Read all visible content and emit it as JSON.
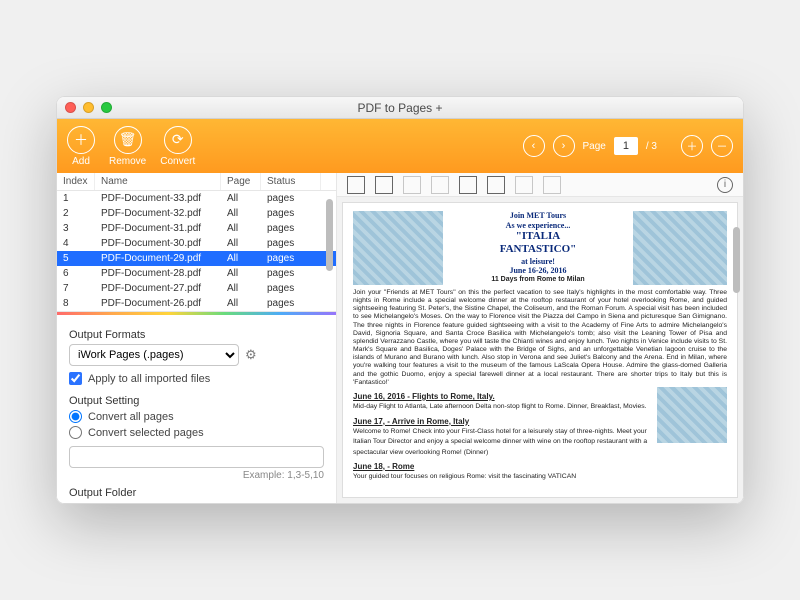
{
  "window": {
    "title": "PDF to Pages +"
  },
  "toolbar": {
    "add": "Add",
    "remove": "Remove",
    "convert": "Convert",
    "page_label": "Page",
    "page_current": "1",
    "page_total": "/ 3"
  },
  "filelist": {
    "headers": {
      "index": "Index",
      "name": "Name",
      "page": "Page",
      "status": "Status"
    },
    "rows": [
      {
        "index": "1",
        "name": "PDF-Document-33.pdf",
        "page": "All",
        "status": "pages"
      },
      {
        "index": "2",
        "name": "PDF-Document-32.pdf",
        "page": "All",
        "status": "pages"
      },
      {
        "index": "3",
        "name": "PDF-Document-31.pdf",
        "page": "All",
        "status": "pages"
      },
      {
        "index": "4",
        "name": "PDF-Document-30.pdf",
        "page": "All",
        "status": "pages"
      },
      {
        "index": "5",
        "name": "PDF-Document-29.pdf",
        "page": "All",
        "status": "pages",
        "selected": true
      },
      {
        "index": "6",
        "name": "PDF-Document-28.pdf",
        "page": "All",
        "status": "pages"
      },
      {
        "index": "7",
        "name": "PDF-Document-27.pdf",
        "page": "All",
        "status": "pages"
      },
      {
        "index": "8",
        "name": "PDF-Document-26.pdf",
        "page": "All",
        "status": "pages"
      }
    ]
  },
  "settings": {
    "output_formats_label": "Output Formats",
    "format_selected": "iWork Pages (.pages)",
    "apply_all": "Apply to all imported files",
    "output_setting_label": "Output Setting",
    "convert_all": "Convert all pages",
    "convert_selected": "Convert selected pages",
    "range_example": "Example: 1,3-5,10",
    "output_folder_label": "Output Folder"
  },
  "preview": {
    "head": {
      "l1": "Join MET Tours",
      "l2": "As we experience...",
      "l3": "\"ITALIA",
      "l4": "FANTASTICO\"",
      "l5": "at leisure!",
      "l6": "June 16-26, 2016",
      "l7": "11 Days from Rome to Milan"
    },
    "intro": "Join your \"Friends at MET Tours\" on this the perfect vacation to see Italy's highlights in the most comfortable way. Three nights in Rome include a special welcome dinner at the rooftop restaurant of your hotel overlooking Rome, and guided sightseeing featuring St. Peter's, the Sistine Chapel, the Coliseum, and the Roman Forum. A special visit has been included to see Michelangelo's Moses. On the way to Florence visit the Piazza del Campo in Siena and picturesque San Gimignano. The three nights in Florence feature guided sightseeing with a visit to the Academy of Fine Arts to admire Michelangelo's David, Signoria Square, and Santa Croce Basilica with Michelangelo's tomb; also visit the Leaning Tower of Pisa and splendid Verrazzano Castle, where you will taste the Chianti wines and enjoy lunch. Two nights in Venice include visits to St. Mark's Square and Basilica, Doges' Palace with the Bridge of Sighs, and an unforgettable Venetian lagoon cruise to the islands of Murano and Burano with lunch. Also stop in Verona and see Juliet's Balcony and the Arena. End in Milan, where you're walking tour features a visit to the museum of the famous LaScala Opera House. Admire the glass-domed Galleria and the gothic Duomo, enjoy a special farewell dinner at a local restaurant. There are shorter trips to Italy but this is 'Fantastico!'",
    "day1_h": "June 16, 2016 - Flights to Rome, Italy.",
    "day1_b": "Mid-day Flight to Atlanta, Late afternoon Delta non-stop flight to Rome. Dinner, Breakfast, Movies.",
    "day2_h": "June 17, - Arrive in Rome, Italy",
    "day2_b": "Welcome to Rome! Check into your First-Class hotel for a leisurely stay of three-nights. Meet your Italian Tour Director and enjoy a special welcome dinner with wine on the rooftop restaurant with a spectacular view overlooking Rome! (Dinner)",
    "day3_h": "June 18, - Rome",
    "day3_b": "Your guided tour focuses on religious Rome: visit the fascinating VATICAN"
  }
}
